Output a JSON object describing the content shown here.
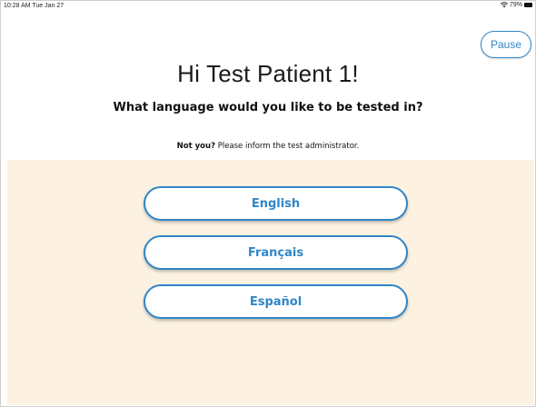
{
  "status_bar": {
    "time": "10:28 AM   Tue Jan 27",
    "battery": "79%"
  },
  "header": {
    "pause_label": "Pause"
  },
  "greeting": "Hi Test Patient 1!",
  "question": "What language would you like to be tested in?",
  "not_you": {
    "emphasis": "Not you?",
    "message": " Please inform the test administrator."
  },
  "languages": [
    {
      "label": "English"
    },
    {
      "label": "Français"
    },
    {
      "label": "Español"
    }
  ],
  "colors": {
    "accent": "#2f86c8",
    "choice_background": "#fdf2e1"
  },
  "icons": {
    "wifi": "wifi-icon",
    "battery": "battery-icon"
  }
}
